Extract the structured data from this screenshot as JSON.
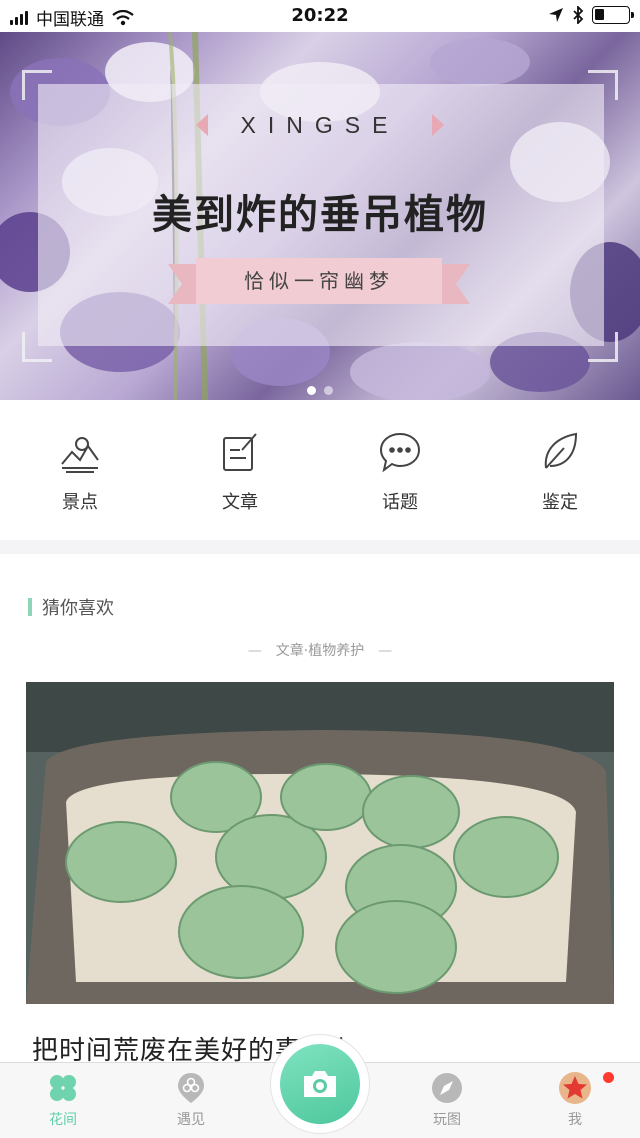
{
  "status_bar": {
    "carrier": "中国联通",
    "time": "20:22",
    "battery_level": 0.3
  },
  "banner": {
    "subtitle": "XINGSE",
    "title": "美到炸的垂吊植物",
    "ribbon_text": "恰似一帘幽梦",
    "page_count": 2,
    "active_page": 1
  },
  "quick_menu": [
    {
      "label": "景点",
      "icon": "mountain-photo-icon"
    },
    {
      "label": "文章",
      "icon": "edit-note-icon"
    },
    {
      "label": "话题",
      "icon": "chat-bubble-icon"
    },
    {
      "label": "鉴定",
      "icon": "leaf-icon"
    }
  ],
  "feed": {
    "section_title": "猜你喜欢",
    "category": "文章·植物养护",
    "card_title": "把时间荒废在美好的事物上",
    "card_image": "succulent-pot-image"
  },
  "tab_bar": {
    "items": [
      {
        "label": "花间",
        "icon": "clover-icon",
        "active": true
      },
      {
        "label": "遇见",
        "icon": "location-pin-icon",
        "active": false
      },
      {
        "label": "",
        "icon": "camera-icon",
        "active": false
      },
      {
        "label": "玩图",
        "icon": "compass-icon",
        "active": false
      },
      {
        "label": "我",
        "icon": "avatar-star-icon",
        "active": false
      }
    ],
    "has_notification": true
  },
  "colors": {
    "accent": "#5fcfa9",
    "ribbon": "#f1ccd2",
    "notification": "#ff3b30"
  }
}
